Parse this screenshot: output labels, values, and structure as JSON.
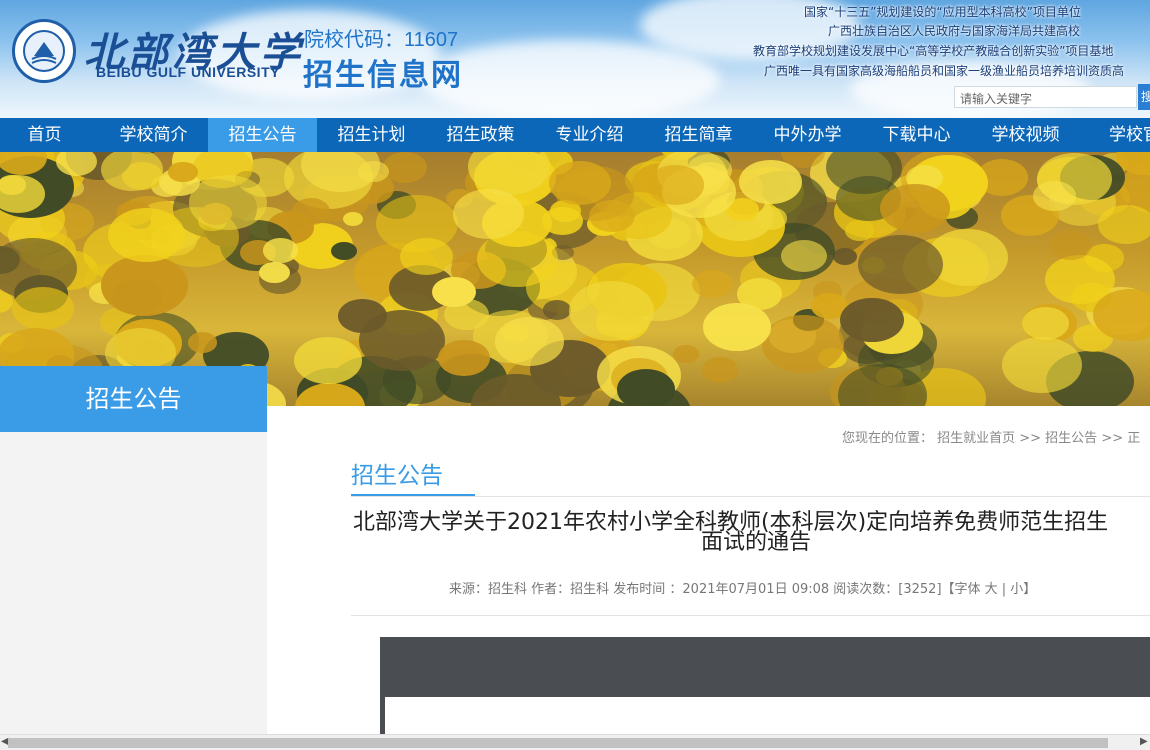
{
  "header": {
    "cn_name": "北部湾大学",
    "en_name": "BEIBU GULF UNIVERSITY",
    "code_text": "院校代码：11607",
    "site_title": "招生信息网",
    "mottos": [
      "国家“十三五”规划建设的“应用型本科高校”项目单位",
      "广西壮族自治区人民政府与国家海洋局共建高校",
      "教育部学校规划建设发展中心“高等学校产教融合创新实验”项目基地",
      "广西唯一具有国家高级海船船员和国家一级渔业船员培养培训资质高"
    ],
    "search_placeholder": "请输入关键字",
    "search_button": "搜"
  },
  "nav": {
    "items": [
      "首页",
      "学校简介",
      "招生公告",
      "招生计划",
      "招生政策",
      "专业介绍",
      "招生简章",
      "中外办学",
      "下载中心",
      "学校视频",
      "学校官"
    ],
    "active_index": 2
  },
  "sidebar": {
    "title": "招生公告"
  },
  "breadcrumb": "您现在的位置： 招生就业首页 >> 招生公告 >> 正",
  "section": {
    "title": "招生公告"
  },
  "article": {
    "title_line1": "北部湾大学关于2021年农村小学全科教师(本科层次)定向培养免费师范生招生",
    "title_line2": "面试的通告",
    "meta": "来源：招生科   作者：招生科   发布时间 ：2021年07月01日 09:08   阅读次数：[3252]【字体 大 | 小】"
  },
  "colors": {
    "nav_bg": "#0d67b8",
    "accent": "#3a9be6",
    "brand_text": "#1a4f95"
  }
}
